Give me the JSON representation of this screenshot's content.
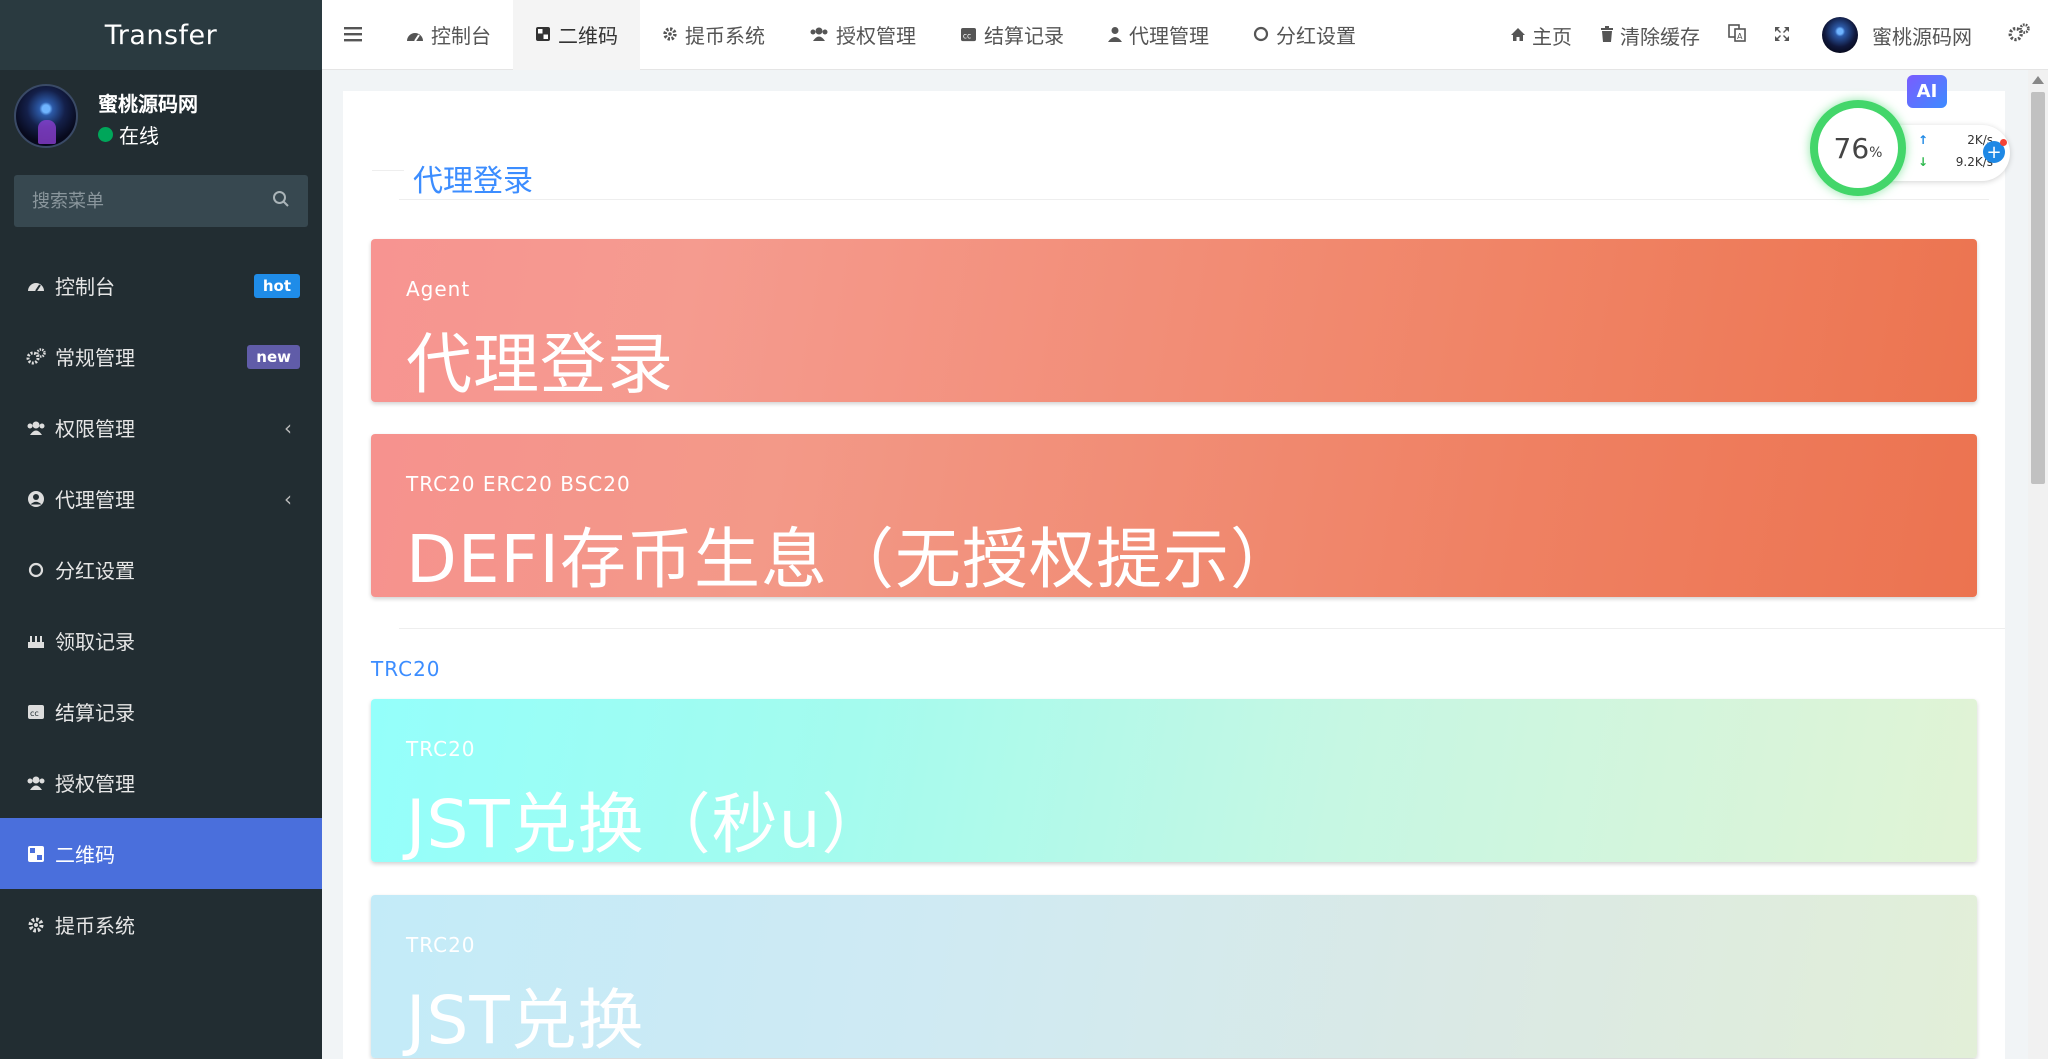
{
  "sidebar": {
    "logo": "Transfer",
    "user": {
      "name": "蜜桃源码网",
      "status": "在线"
    },
    "search_placeholder": "搜索菜单",
    "items": [
      {
        "label": "控制台",
        "icon": "dashboard-icon",
        "badge": "hot"
      },
      {
        "label": "常规管理",
        "icon": "cogs-icon",
        "badge": "new"
      },
      {
        "label": "权限管理",
        "icon": "users-icon"
      },
      {
        "label": "代理管理",
        "icon": "user-circle-icon"
      },
      {
        "label": "分红设置",
        "icon": "circle-icon"
      },
      {
        "label": "领取记录",
        "icon": "cake-icon"
      },
      {
        "label": "结算记录",
        "icon": "cc-icon"
      },
      {
        "label": "授权管理",
        "icon": "users-icon"
      },
      {
        "label": "二维码",
        "icon": "qrcode-icon",
        "active": true
      },
      {
        "label": "提币系统",
        "icon": "gear-icon"
      }
    ]
  },
  "topbar": {
    "tabs": [
      {
        "label": "控制台",
        "icon": "dashboard-icon"
      },
      {
        "label": "二维码",
        "icon": "qrcode-icon",
        "active": true
      },
      {
        "label": "提币系统",
        "icon": "gear-icon"
      },
      {
        "label": "授权管理",
        "icon": "users-icon"
      },
      {
        "label": "结算记录",
        "icon": "cc-icon"
      },
      {
        "label": "代理管理",
        "icon": "user-icon"
      },
      {
        "label": "分红设置",
        "icon": "circle-icon"
      }
    ],
    "right": {
      "home": "主页",
      "clear_cache": "清除缓存",
      "user_name": "蜜桃源码网"
    }
  },
  "main": {
    "section_title": "代理登录",
    "cards": [
      {
        "sub": "Agent",
        "title": "代理登录"
      },
      {
        "sub": "TRC20 ERC20 BSC20",
        "title": "DEFI存币生息（无授权提示）"
      },
      {
        "sub": "TRC20",
        "title": "JST兑换（秒u）"
      },
      {
        "sub": "TRC20",
        "title": "JST兑换"
      }
    ],
    "group_label": "TRC20"
  },
  "widget": {
    "percent": "76",
    "percent_unit": "%",
    "upload": "2K/s",
    "download": "9.2K/s",
    "ai_label": "AI"
  },
  "colors": {
    "sidebar_bg": "#222d32",
    "sidebar_active": "#4a6fdc",
    "accent_blue": "#3c8dff",
    "badge_hot": "#1f8ce8",
    "badge_new": "#605ca8",
    "online": "#00a65a"
  }
}
